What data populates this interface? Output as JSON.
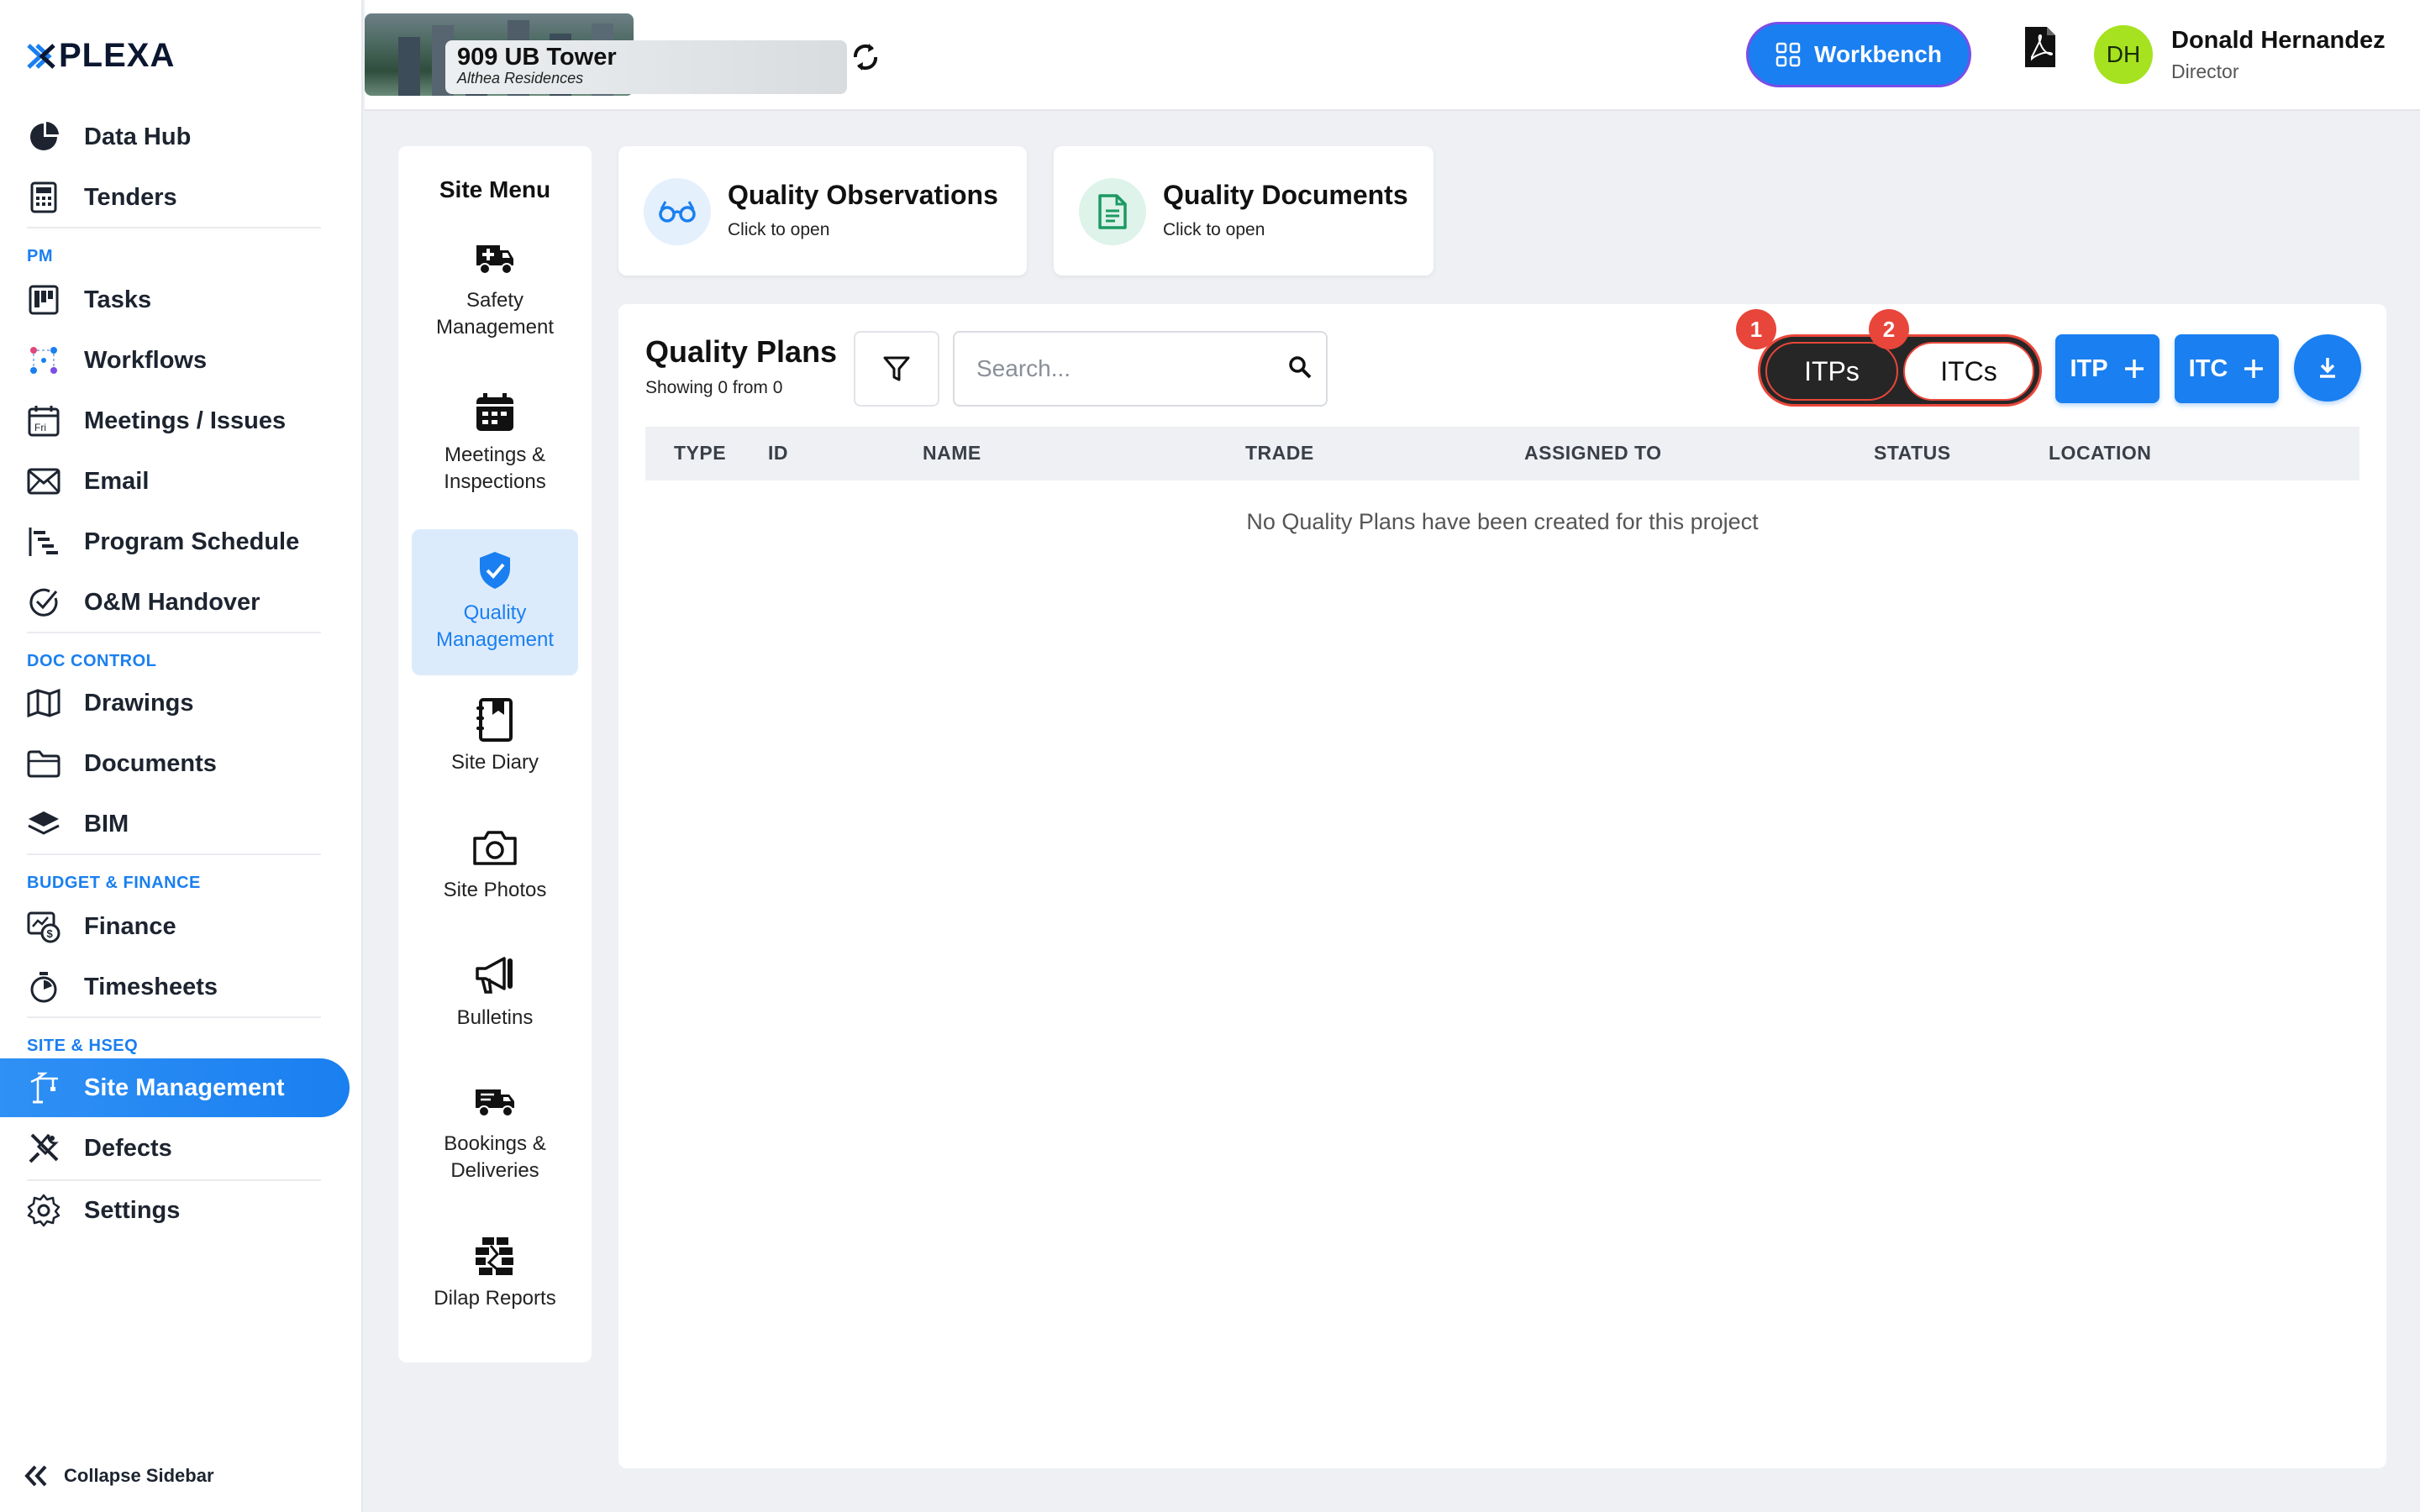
{
  "app": {
    "brand": "PLEXA",
    "brand_mark": "✖"
  },
  "colors": {
    "accent": "#1a7ff0",
    "highlight": "#e8463a",
    "avatar": "#a6e21f"
  },
  "sidebar": {
    "items": [
      {
        "label": "Data Hub",
        "icon": "pie-chart-icon"
      },
      {
        "label": "Tenders",
        "icon": "calculator-icon"
      },
      {
        "label": "Tasks",
        "icon": "kanban-icon"
      },
      {
        "label": "Workflows",
        "icon": "workflow-icon"
      },
      {
        "label": "Meetings / Issues",
        "icon": "calendar-icon"
      },
      {
        "label": "Email",
        "icon": "envelope-icon"
      },
      {
        "label": "Program Schedule",
        "icon": "gantt-icon"
      },
      {
        "label": "O&M Handover",
        "icon": "check-circle-icon"
      },
      {
        "label": "Drawings",
        "icon": "map-icon"
      },
      {
        "label": "Documents",
        "icon": "folder-icon"
      },
      {
        "label": "BIM",
        "icon": "layers-icon"
      },
      {
        "label": "Finance",
        "icon": "finance-icon"
      },
      {
        "label": "Timesheets",
        "icon": "stopwatch-icon"
      },
      {
        "label": "Site Management",
        "icon": "crane-icon"
      },
      {
        "label": "Defects",
        "icon": "tools-icon"
      },
      {
        "label": "Settings",
        "icon": "gear-icon"
      }
    ],
    "sections": {
      "pm": "PM",
      "doc_control": "DOC CONTROL",
      "budget": "BUDGET & FINANCE",
      "site": "SITE & HSEQ"
    },
    "collapse_label": "Collapse Sidebar"
  },
  "header": {
    "project_name": "909 UB Tower",
    "project_sub": "Althea Residences",
    "workbench_label": "Workbench",
    "user_initials": "DH",
    "user_name": "Donald Hernandez",
    "user_role": "Director"
  },
  "site_menu": {
    "title": "Site Menu",
    "items": [
      {
        "label": "Safety Management",
        "icon": "ambulance-icon"
      },
      {
        "label": "Meetings & Inspections",
        "icon": "calendar-grid-icon"
      },
      {
        "label": "Quality Management",
        "icon": "shield-check-icon"
      },
      {
        "label": "Site Diary",
        "icon": "diary-icon"
      },
      {
        "label": "Site Photos",
        "icon": "camera-icon"
      },
      {
        "label": "Bulletins",
        "icon": "megaphone-icon"
      },
      {
        "label": "Bookings & Deliveries",
        "icon": "truck-icon"
      },
      {
        "label": "Dilap Reports",
        "icon": "brick-wall-icon"
      }
    ]
  },
  "quick_cards": [
    {
      "title": "Quality Observations",
      "sub": "Click to open",
      "icon": "glasses-icon"
    },
    {
      "title": "Quality Documents",
      "sub": "Click to open",
      "icon": "document-icon"
    }
  ],
  "quality_plans": {
    "title": "Quality Plans",
    "subtitle": "Showing 0 from 0",
    "search_placeholder": "Search...",
    "toggle": {
      "itps": "ITPs",
      "itcs": "ITCs"
    },
    "badges": {
      "one": "1",
      "two": "2"
    },
    "add_itp": "ITP",
    "add_itc": "ITC",
    "columns": [
      "TYPE",
      "ID",
      "NAME",
      "TRADE",
      "ASSIGNED TO",
      "STATUS",
      "LOCATION"
    ],
    "empty_message": "No Quality Plans have been created for this project"
  }
}
